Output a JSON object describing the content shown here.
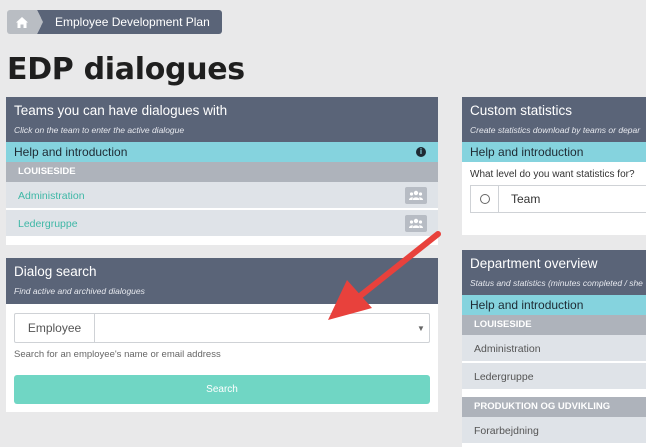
{
  "breadcrumb": {
    "home_icon": "home-icon",
    "current": "Employee Development Plan"
  },
  "page_title": "EDP dialogues",
  "teams_panel": {
    "title": "Teams you can have dialogues with",
    "subtitle": "Click on the team to enter the active dialogue",
    "help": "Help and introduction",
    "group": "LOUISESIDE",
    "teams": [
      "Administration",
      "Ledergruppe"
    ]
  },
  "search_panel": {
    "title": "Dialog search",
    "subtitle": "Find active and archived dialogues",
    "field_label": "Employee",
    "field_value": "",
    "hint": "Search for an employee's name or email address",
    "button": "Search"
  },
  "custom_stats": {
    "title": "Custom statistics",
    "subtitle": "Create statistics download by teams or depar",
    "help": "Help and introduction",
    "question": "What level do you want statistics for?",
    "option": "Team"
  },
  "dept_overview": {
    "title": "Department overview",
    "subtitle": "Status and statistics (minutes completed / she",
    "help": "Help and introduction",
    "groups": [
      {
        "name": "LOUISESIDE",
        "items": [
          "Administration",
          "Ledergruppe"
        ]
      },
      {
        "name": "PRODUKTION OG UDVIKLING",
        "items": [
          "Forarbejdning"
        ]
      }
    ]
  },
  "colors": {
    "header": "#5a6478",
    "help": "#85d3de",
    "accent": "#3eb7a6",
    "button": "#70d6c4",
    "arrow": "#e8413c"
  }
}
